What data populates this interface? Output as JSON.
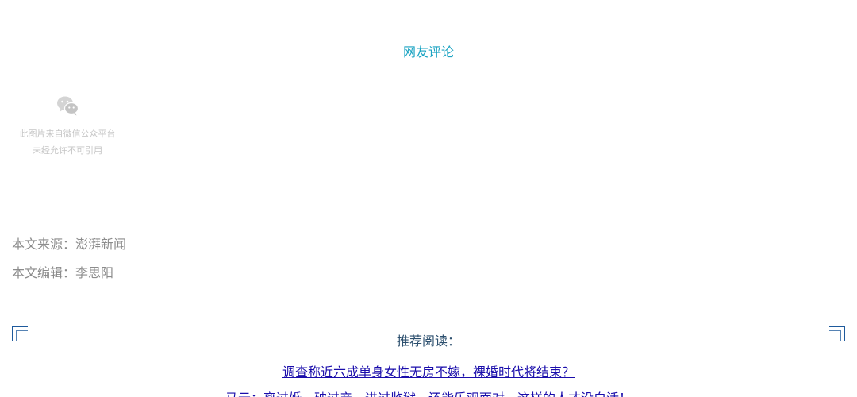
{
  "comments": {
    "title": "网友评论"
  },
  "image_placeholder": {
    "icon": "wechat-icon",
    "line1": "此图片来自微信公众平台",
    "line2": "未经允许不可引用"
  },
  "meta": {
    "source": "本文来源：澎湃新闻",
    "editor": "本文编辑：李思阳"
  },
  "recommended": {
    "heading": "推荐阅读：",
    "articles": [
      "调查称近六成单身女性无房不嫁，裸婚时代将结束？",
      "马云：离过婚，破过产，进过监狱，还能乐观面对，这样的人才没白活！"
    ]
  },
  "colors": {
    "accent": "#1aa3c2",
    "corner_bracket": "#1e5a9c",
    "link": "#1a0dab",
    "meta_text": "#8c8c8c"
  }
}
